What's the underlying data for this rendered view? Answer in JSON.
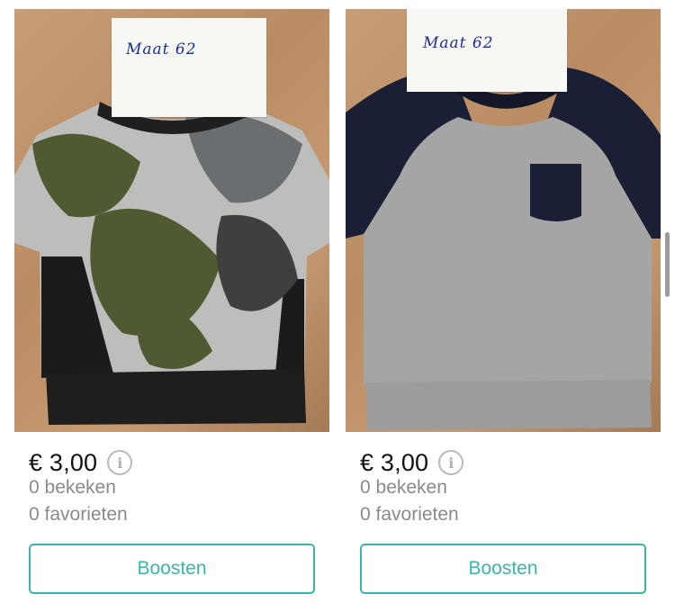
{
  "listings": [
    {
      "size_note": "Maat   62",
      "price": "€ 3,00",
      "info_icon": "info-icon",
      "views": "0 bekeken",
      "favorites": "0 favorieten",
      "boost_label": "Boosten"
    },
    {
      "size_note": "Maat   62",
      "price": "€ 3,00",
      "info_icon": "info-icon",
      "views": "0 bekeken",
      "favorites": "0 favorieten",
      "boost_label": "Boosten"
    }
  ],
  "colors": {
    "accent": "#3ab4ac",
    "muted_text": "#8a8a8a",
    "price_text": "#111111"
  }
}
